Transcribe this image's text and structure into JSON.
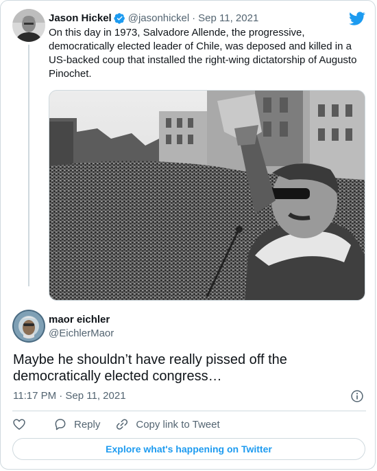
{
  "quoted": {
    "author_name": "Jason Hickel",
    "handle": "@jasonhickel",
    "separator": "·",
    "date": "Sep 11, 2021",
    "text": "On this day in 1973, Salvadore Allende, the progressive, democratically elected leader of Chile, was deposed and killed in a US-backed coup that installed the right-wing dictatorship of Augusto Pinochet.",
    "verified": true
  },
  "reply": {
    "author_name": "maor eichler",
    "handle": "@EichlerMaor",
    "text": "Maybe he shouldn’t have really pissed off the democratically elected congress…",
    "timestamp": "11:17 PM · Sep 11, 2021"
  },
  "actions": {
    "reply_label": "Reply",
    "copy_link_label": "Copy link to Tweet"
  },
  "footer": {
    "explore_label": "Explore what's happening on Twitter"
  },
  "colors": {
    "twitter_blue": "#1d9bf0",
    "text_primary": "#0f1419",
    "text_secondary": "#536471",
    "border": "#cfd9de"
  },
  "icons": [
    "twitter-logo-icon",
    "verified-badge-icon",
    "heart-icon",
    "reply-icon",
    "link-icon",
    "info-icon"
  ]
}
